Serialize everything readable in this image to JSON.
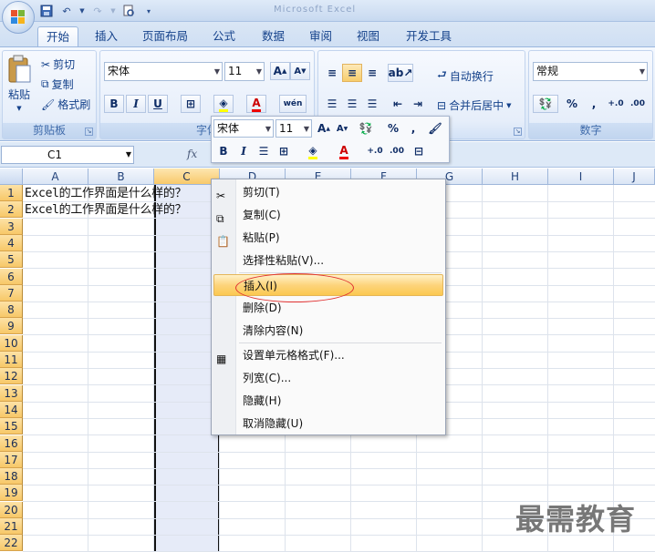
{
  "titlebar": {
    "title": "Microsoft Excel"
  },
  "tabs": [
    "开始",
    "插入",
    "页面布局",
    "公式",
    "数据",
    "审阅",
    "视图",
    "开发工具"
  ],
  "ribbon": {
    "clipboard": {
      "paste": "粘贴",
      "cut": "剪切",
      "copy": "复制",
      "format_painter": "格式刷",
      "label": "剪贴板"
    },
    "font": {
      "name": "宋体",
      "size": "11",
      "label": "字体",
      "grow": "A",
      "shrink": "A",
      "bold": "B",
      "italic": "I",
      "underline": "U",
      "font_color": "A",
      "phonetic": "wén"
    },
    "alignment": {
      "wrap": "自动换行",
      "merge": "合并后居中"
    },
    "number": {
      "format": "常规",
      "label": "数字",
      "percent": "%",
      "comma": ",",
      "inc_decimal": "+.0",
      "dec_decimal": ".00"
    }
  },
  "formula_bar": {
    "name_box": "C1",
    "fx": "fx"
  },
  "grid": {
    "columns": [
      "A",
      "B",
      "C",
      "D",
      "E",
      "F",
      "G",
      "H",
      "I",
      "J"
    ],
    "rows": [
      "1",
      "2",
      "3",
      "4",
      "5",
      "6",
      "7",
      "8",
      "9",
      "10",
      "11",
      "12",
      "13",
      "14",
      "15",
      "16",
      "17",
      "18",
      "19",
      "20",
      "21",
      "22"
    ],
    "cells": {
      "A1": "Excel的工作界面是什么样的？",
      "A2": "Excel的工作界面是什么样的？"
    }
  },
  "mini_toolbar": {
    "font": "宋体",
    "size": "11",
    "grow": "A",
    "shrink": "A",
    "percent": "%",
    "comma": ",",
    "bold": "B",
    "italic": "I",
    "font_color": "A",
    "inc_decimal": "+.0",
    "dec_decimal": ".00"
  },
  "context_menu": {
    "items": [
      "剪切(T)",
      "复制(C)",
      "粘贴(P)",
      "选择性粘贴(V)...",
      "插入(I)",
      "删除(D)",
      "清除内容(N)",
      "设置单元格格式(F)...",
      "列宽(C)...",
      "隐藏(H)",
      "取消隐藏(U)"
    ],
    "highlighted_item": "插入(I)"
  },
  "watermark": "最需教育",
  "colors": {
    "ribbon_bg": "#dbe7f7",
    "selection": "#f8c96b",
    "highlight_ring": "#e03030"
  }
}
